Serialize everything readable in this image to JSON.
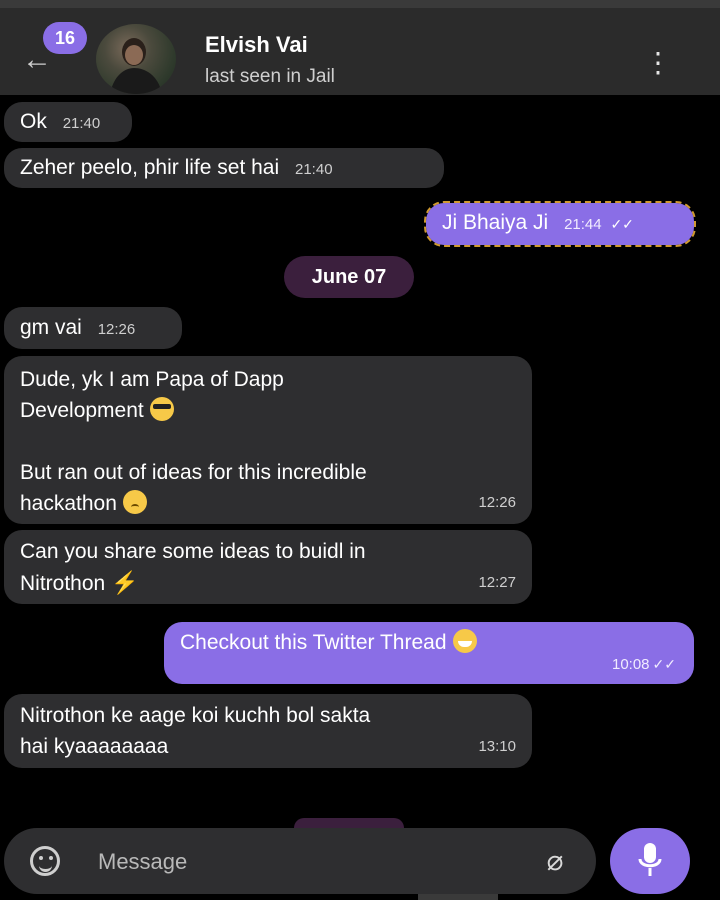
{
  "header": {
    "back_icon": "arrow-left-icon",
    "unread_badge": "16",
    "contact_name": "Elvish Vai",
    "status": "last seen in Jail",
    "menu_icon": "more-vertical-icon"
  },
  "messages": [
    {
      "direction": "in",
      "text": "Ok",
      "time": "21:40"
    },
    {
      "direction": "in",
      "text": "Zeher peelo, phir life set hai",
      "time": "21:40"
    },
    {
      "direction": "out",
      "text": "Ji Bhaiya Ji",
      "time": "21:44",
      "ticks": "✓✓"
    },
    {
      "direction": "in",
      "text": "gm vai",
      "time": "12:26"
    },
    {
      "direction": "in",
      "line1": "Dude, yk I am Papa of Dapp",
      "line2": "Development",
      "line3": "But ran out of ideas for this incredible",
      "line4": "hackathon",
      "time": "12:26",
      "emoji1": "smiling-face-with-sunglasses",
      "emoji2": "crying-face"
    },
    {
      "direction": "in",
      "line1": "Can you share some ideas to buidl in",
      "line2": "Nitrothon",
      "time": "12:27",
      "emoji": "lightning-icon"
    },
    {
      "direction": "out",
      "text": "Checkout this Twitter Thread",
      "time": "10:08",
      "ticks": "✓✓",
      "emoji": "grinning-sweat-emoji"
    },
    {
      "direction": "in",
      "line1": "Nitrothon ke aage koi kuchh bol sakta",
      "line2": "hai kyaaaaaaaa",
      "time": "13:10"
    }
  ],
  "date_separator": "June 07",
  "composer": {
    "emoji_icon": "smile-icon",
    "placeholder": "Message",
    "attach_icon": "paperclip-icon",
    "mic_icon": "microphone-icon"
  },
  "colors": {
    "accent": "#8a6ee6",
    "incoming_bubble": "#2e2e30",
    "date_chip": "#3b1f3d",
    "background": "#000000"
  }
}
